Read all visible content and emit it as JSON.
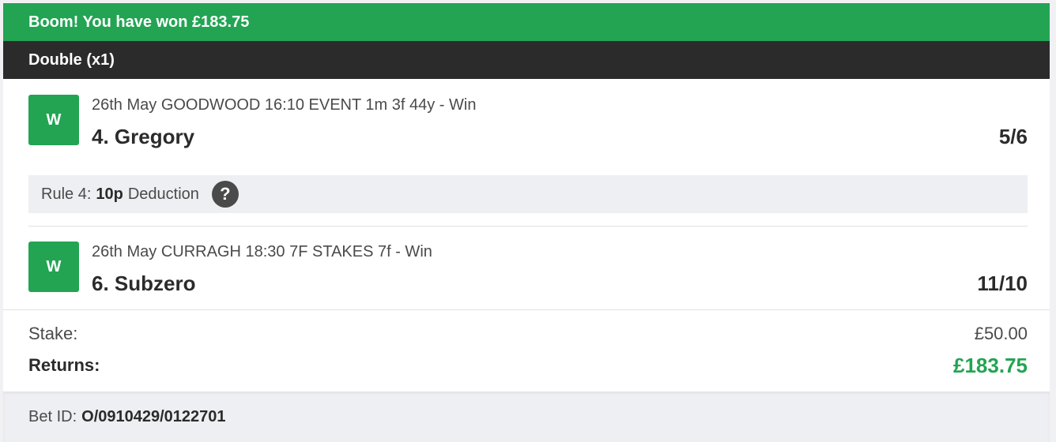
{
  "banner": {
    "text": "Boom! You have won £183.75"
  },
  "bet_type": {
    "label": "Double (x1)"
  },
  "selections": [
    {
      "result": "W",
      "event": "26th May GOODWOOD 16:10 EVENT 1m 3f 44y - Win",
      "runner": "4. Gregory",
      "odds": "5/6"
    },
    {
      "result": "W",
      "event": "26th May CURRAGH 18:30 7F STAKES 7f - Win",
      "runner": "6. Subzero",
      "odds": "11/10"
    }
  ],
  "rule4": {
    "prefix": "Rule 4:",
    "deduction": "10p",
    "suffix": "Deduction",
    "help_icon": "?"
  },
  "summary": {
    "stake_label": "Stake:",
    "stake_value": "£50.00",
    "returns_label": "Returns:",
    "returns_value": "£183.75"
  },
  "footer": {
    "bet_id_label": "Bet ID:",
    "bet_id_value": "O/0910429/0122701"
  },
  "colors": {
    "win_green": "#22a453",
    "header_dark": "#2b2b2b",
    "panel_grey": "#eeeff2"
  }
}
